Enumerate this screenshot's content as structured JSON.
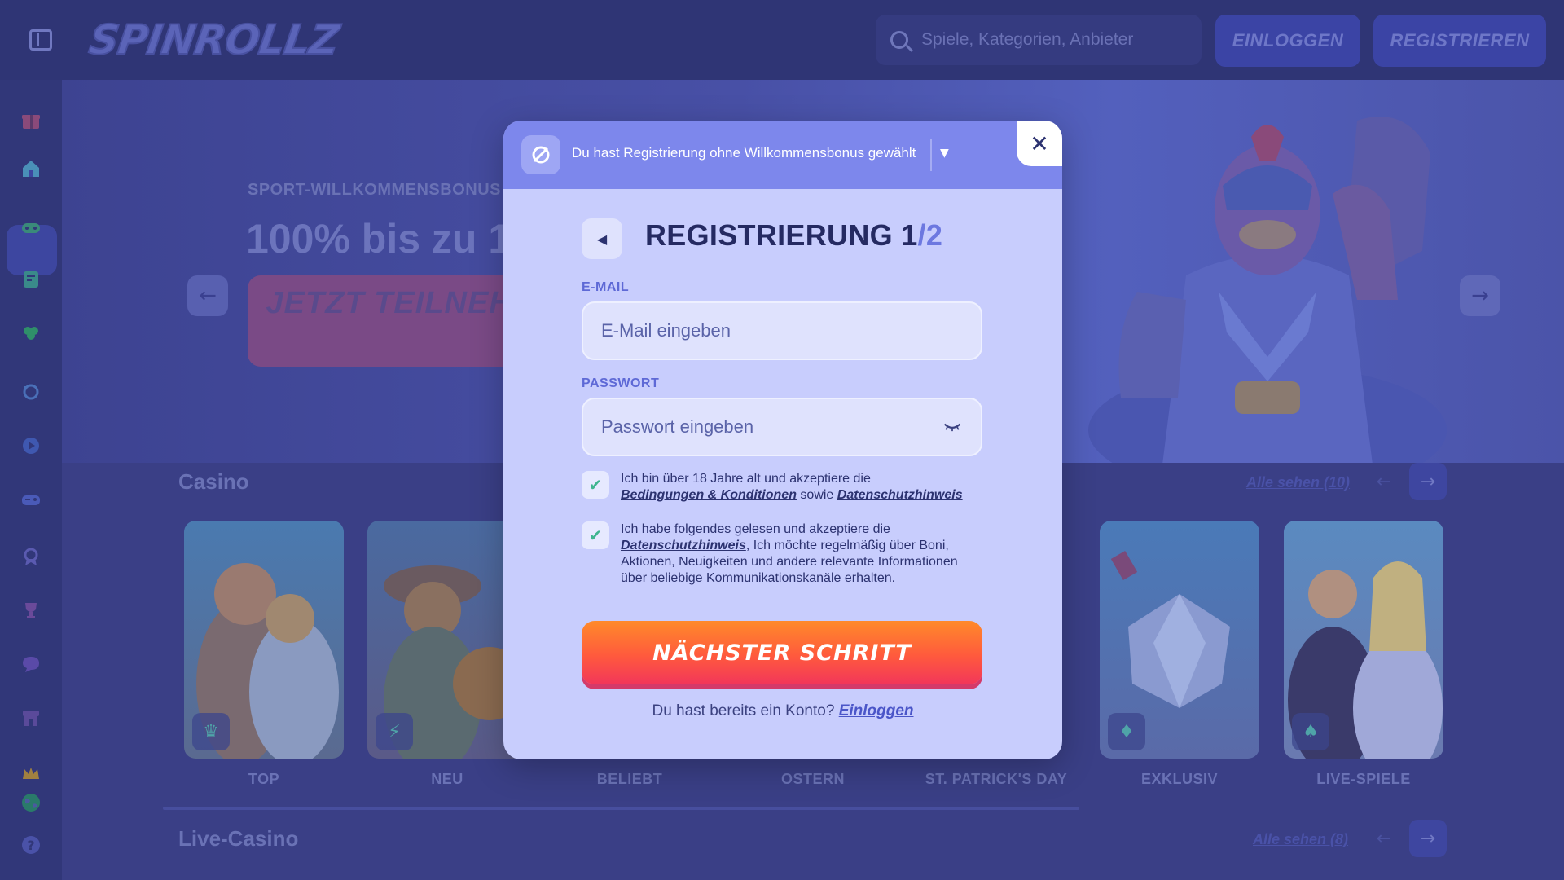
{
  "header": {
    "logo": "SPINROLLZ",
    "search_placeholder": "Spiele, Kategorien, Anbieter",
    "login_label": "EINLOGGEN",
    "register_label": "REGISTRIEREN"
  },
  "sidebar": {
    "items": [
      {
        "icon": "gift-icon"
      },
      {
        "icon": "home-icon"
      },
      {
        "icon": "controller-icon"
      },
      {
        "icon": "sports-icon"
      },
      {
        "icon": "clover-icon"
      },
      {
        "icon": "refresh-icon"
      },
      {
        "icon": "play-icon"
      },
      {
        "icon": "gamepad-icon"
      },
      {
        "icon": "medal-icon"
      },
      {
        "icon": "trophy-icon"
      },
      {
        "icon": "chat-icon"
      },
      {
        "icon": "shop-icon"
      },
      {
        "icon": "crown-icon"
      },
      {
        "icon": "globe-icon"
      },
      {
        "icon": "help-icon"
      }
    ]
  },
  "hero": {
    "subtitle": "SPORT-WILLKOMMENSBONUS",
    "title": "100% bis zu 1",
    "cta": "JETZT TEILNEHM"
  },
  "casino": {
    "title": "Casino",
    "see_all": "Alle sehen (10)",
    "categories": [
      {
        "label": "TOP",
        "icon": "crown-icon"
      },
      {
        "label": "NEU",
        "icon": "lightning-icon"
      },
      {
        "label": "BELIEBT",
        "icon": ""
      },
      {
        "label": "OSTERN",
        "icon": ""
      },
      {
        "label": "ST. PATRICK'S DAY",
        "icon": ""
      },
      {
        "label": "EXKLUSIV",
        "icon": "diamond-icon"
      },
      {
        "label": "LIVE-SPIELE",
        "icon": "cards-icon"
      }
    ]
  },
  "live_casino": {
    "title": "Live-Casino",
    "see_all": "Alle sehen (8)"
  },
  "modal": {
    "bonus_notice": "Du hast Registrierung ohne Willkommensbonus gewählt",
    "title": "REGISTRIERUNG 1",
    "title_total": "/2",
    "email_label": "E-MAIL",
    "email_placeholder": "E-Mail eingeben",
    "password_label": "PASSWORT",
    "password_placeholder": "Passwort eingeben",
    "terms": {
      "text_1": "Ich bin über 18 Jahre alt und akzeptiere die",
      "link_terms": "Bedingungen & Konditionen",
      "text_2": "sowie",
      "link_privacy": "Datenschutzhinweis",
      "checked": true
    },
    "marketing": {
      "text_1": "Ich habe folgendes gelesen und akzeptiere die",
      "link_privacy": "Datenschutzhinweis",
      "text_2": ", Ich möchte regelmäßig über Boni, Aktionen, Neuigkeiten und andere relevante Informationen über beliebige Kommunikationskanäle erhalten.",
      "checked": true
    },
    "next_button": "NÄCHSTER SCHRITT",
    "account_question": "Du hast bereits ein Konto?",
    "login_link": "Einloggen"
  },
  "colors": {
    "overlay_bg": "#3a3f86",
    "modal_bg": "#c8cdfd",
    "modal_header": "#7d87ec",
    "accent": "#5e69d6",
    "check_green": "#3fb58f",
    "cta_orange": "#ff8a2a",
    "cta_pink": "#f2365a"
  }
}
